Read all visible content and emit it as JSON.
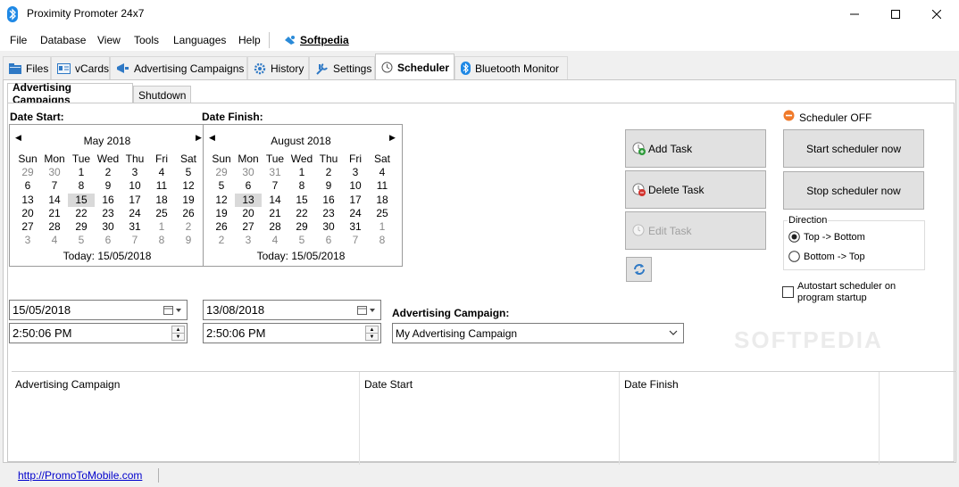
{
  "window": {
    "title": "Proximity Promoter 24x7"
  },
  "menu": {
    "items": [
      "File",
      "Database",
      "View",
      "Tools",
      "Languages",
      "Help"
    ],
    "softpedia": "Softpedia"
  },
  "tabs": [
    "Files",
    "vCards",
    "Advertising Campaigns",
    "History",
    "Settings",
    "Scheduler",
    "Bluetooth Monitor"
  ],
  "subtabs": [
    "Advertising Campaigns",
    "Shutdown"
  ],
  "scheduler": {
    "date_start_label": "Date Start:",
    "date_finish_label": "Date Finish:",
    "weekdays": [
      "Sun",
      "Mon",
      "Tue",
      "Wed",
      "Thu",
      "Fri",
      "Sat"
    ],
    "cal_start": {
      "month": "May 2018",
      "today": "Today: 15/05/2018",
      "selected": "15",
      "rows": [
        [
          "29",
          "30",
          "1",
          "2",
          "3",
          "4",
          "5"
        ],
        [
          "6",
          "7",
          "8",
          "9",
          "10",
          "11",
          "12"
        ],
        [
          "13",
          "14",
          "15",
          "16",
          "17",
          "18",
          "19"
        ],
        [
          "20",
          "21",
          "22",
          "23",
          "24",
          "25",
          "26"
        ],
        [
          "27",
          "28",
          "29",
          "30",
          "31",
          "1",
          "2"
        ],
        [
          "3",
          "4",
          "5",
          "6",
          "7",
          "8",
          "9"
        ]
      ],
      "dim": [
        [
          0,
          0
        ],
        [
          0,
          1
        ],
        [
          4,
          5
        ],
        [
          4,
          6
        ],
        [
          5,
          0
        ],
        [
          5,
          1
        ],
        [
          5,
          2
        ],
        [
          5,
          3
        ],
        [
          5,
          4
        ],
        [
          5,
          5
        ],
        [
          5,
          6
        ]
      ]
    },
    "cal_finish": {
      "month": "August 2018",
      "today": "Today: 15/05/2018",
      "selected": "13",
      "rows": [
        [
          "29",
          "30",
          "31",
          "1",
          "2",
          "3",
          "4"
        ],
        [
          "5",
          "6",
          "7",
          "8",
          "9",
          "10",
          "11"
        ],
        [
          "12",
          "13",
          "14",
          "15",
          "16",
          "17",
          "18"
        ],
        [
          "19",
          "20",
          "21",
          "22",
          "23",
          "24",
          "25"
        ],
        [
          "26",
          "27",
          "28",
          "29",
          "30",
          "31",
          "1"
        ],
        [
          "2",
          "3",
          "4",
          "5",
          "6",
          "7",
          "8"
        ]
      ],
      "dim": [
        [
          0,
          0
        ],
        [
          0,
          1
        ],
        [
          0,
          2
        ],
        [
          4,
          6
        ],
        [
          5,
          0
        ],
        [
          5,
          1
        ],
        [
          5,
          2
        ],
        [
          5,
          3
        ],
        [
          5,
          4
        ],
        [
          5,
          5
        ],
        [
          5,
          6
        ]
      ]
    },
    "start_date": "15/05/2018",
    "start_time": "2:50:06 PM",
    "finish_date": "13/08/2018",
    "finish_time": "2:50:06 PM",
    "campaign_label": "Advertising Campaign:",
    "campaign_value": "My Advertising Campaign",
    "add_task": "Add Task",
    "delete_task": "Delete Task",
    "edit_task": "Edit Task",
    "scheduler_status": "Scheduler OFF",
    "start_now": "Start scheduler now",
    "stop_now": "Stop scheduler now",
    "direction_label": "Direction",
    "dir_top_bottom": "Top -> Bottom",
    "dir_bottom_top": "Bottom -> Top",
    "dir_selected": "top_bottom",
    "autostart": "Autostart scheduler on program startup",
    "autostart_checked": false,
    "columns": [
      "Advertising Campaign",
      "Date Start",
      "Date Finish"
    ]
  },
  "status": {
    "url": "http://PromoToMobile.com"
  },
  "watermark": "SOFTPEDIA",
  "colors": {
    "status_off": "#f07a2a",
    "bluetooth": "#1e88e5",
    "link": "#0000cc"
  }
}
